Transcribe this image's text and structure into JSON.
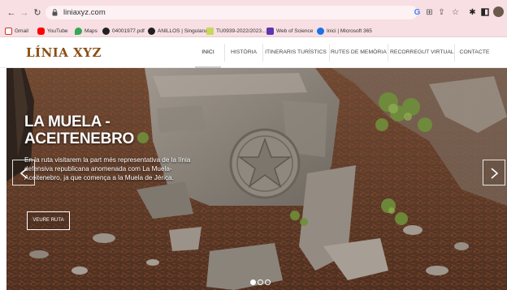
{
  "browser": {
    "url": "liniaxyz.com",
    "toolbar_icons": [
      "google-g-icon",
      "translate-icon",
      "share-icon",
      "star-icon",
      "extensions-icon",
      "window-icon",
      "profile-avatar-icon"
    ]
  },
  "bookmarks": [
    {
      "label": "Gmail",
      "icon": "gmail-icon",
      "color": "#d93025"
    },
    {
      "label": "YouTube",
      "icon": "youtube-icon",
      "color": "#ff0000"
    },
    {
      "label": "Maps",
      "icon": "maps-icon",
      "color": "#34a853"
    },
    {
      "label": "04001977.pdf",
      "icon": "document-icon",
      "color": "#202124"
    },
    {
      "label": "ANILLOS | Singularu",
      "icon": "singularu-icon",
      "color": "#202124"
    },
    {
      "label": "TU0939-2022/2023...",
      "icon": "spreadsheet-icon",
      "color": "#8ab4f8"
    },
    {
      "label": "Web of Science",
      "icon": "web-of-science-icon",
      "color": "#5e35b1"
    },
    {
      "label": "Inici | Microsoft 365",
      "icon": "microsoft-365-icon",
      "color": "#1a73e8"
    }
  ],
  "site": {
    "logo": "LÍNIA XYZ",
    "brand_color": "#8a4e14",
    "menu": [
      "INICI",
      "HISTÒRIA",
      "ITINERARIS TURÍSTICS",
      "RUTES DE MEMÒRIA",
      "RECORREGUT VIRTUAL",
      "CONTACTE"
    ],
    "active_menu": "INICI"
  },
  "hero": {
    "title": "LA MUELA - ACEITENEBRO",
    "description": "En la ruta visitarem la part més representativa de la línia defensiva republicana anomenada com La Muela- Aceitenebro, ja que comença a la Muela de Jérica.",
    "button": "VEURE RUTA",
    "slides_total": 3,
    "active_slide": 1
  }
}
